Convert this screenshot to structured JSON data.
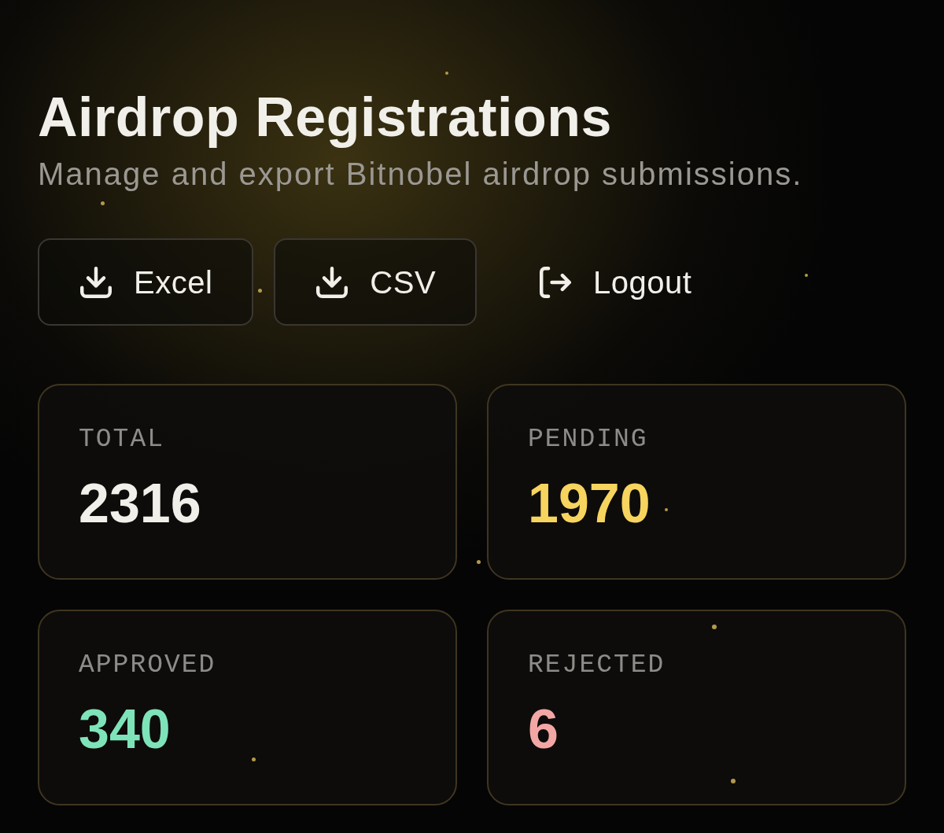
{
  "header": {
    "title": "Airdrop Registrations",
    "subtitle": "Manage and export Bitnobel airdrop submissions."
  },
  "actions": [
    {
      "kind": "download",
      "label": "Excel"
    },
    {
      "kind": "download",
      "label": "CSV"
    },
    {
      "kind": "logout",
      "label": "Logout"
    }
  ],
  "stats": [
    {
      "label": "TOTAL",
      "value": "2316",
      "color": "#f1efe9"
    },
    {
      "label": "PENDING",
      "value": "1970",
      "color": "#f6d45e"
    },
    {
      "label": "APPROVED",
      "value": "340",
      "color": "#7fe3b9"
    },
    {
      "label": "REJECTED",
      "value": "6",
      "color": "#f3a7a5"
    }
  ]
}
